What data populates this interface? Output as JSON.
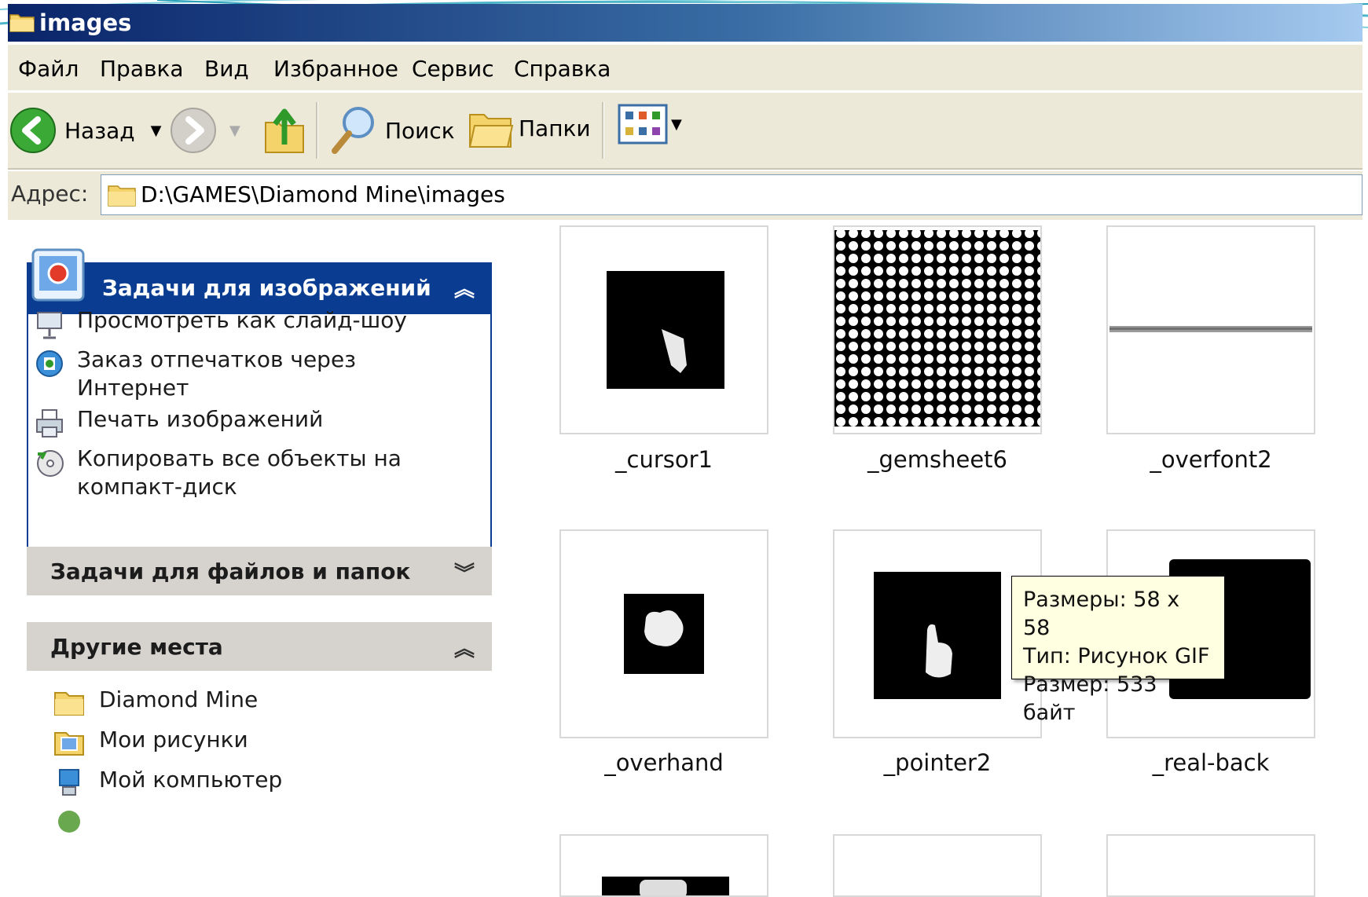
{
  "window": {
    "title": "images"
  },
  "menu": [
    "Файл",
    "Правка",
    "Вид",
    "Избранное",
    "Сервис",
    "Справка"
  ],
  "toolbar": {
    "back_label": "Назад",
    "search_label": "Поиск",
    "folders_label": "Папки"
  },
  "address": {
    "label": "Адрес:",
    "value": "D:\\GAMES\\Diamond Mine\\images"
  },
  "image_tasks": {
    "title": "Задачи для изображений",
    "items": [
      {
        "label": "Просмотреть как слайд-шоу",
        "icon": "slideshow-icon"
      },
      {
        "label": "Заказ отпечатков через Интернет",
        "icon": "order-prints-icon"
      },
      {
        "label": "Печать изображений",
        "icon": "print-icon"
      },
      {
        "label": "Копировать все объекты на компакт-диск",
        "icon": "cd-copy-icon"
      }
    ]
  },
  "file_tasks": {
    "title": "Задачи для файлов и папок"
  },
  "other_places": {
    "title": "Другие места",
    "items": [
      {
        "label": "Diamond Mine",
        "icon": "folder-icon"
      },
      {
        "label": "Мои рисунки",
        "icon": "my-pictures-icon"
      },
      {
        "label": "Мой компьютер",
        "icon": "my-computer-icon"
      }
    ]
  },
  "files": [
    {
      "name": "_cursor1"
    },
    {
      "name": "_gemsheet6"
    },
    {
      "name": "_overfont2"
    },
    {
      "name": "_overhand"
    },
    {
      "name": "_pointer2"
    },
    {
      "name": "_real-back"
    }
  ],
  "tooltip": {
    "line1": "Размеры: 58 x 58",
    "line2": "Тип: Рисунок GIF",
    "line3": "Размер: 533 байт"
  }
}
